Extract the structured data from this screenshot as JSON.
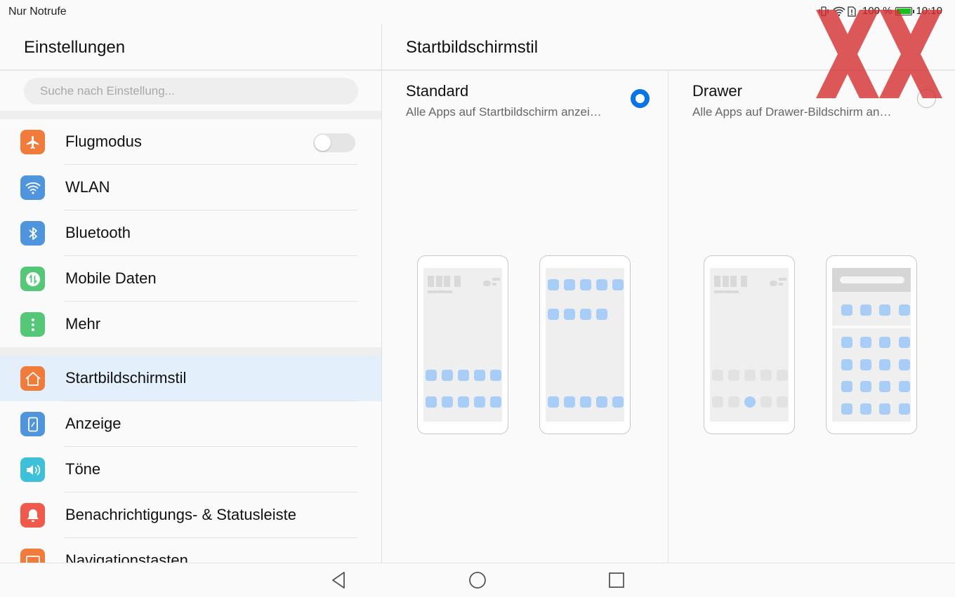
{
  "statusbar": {
    "carrier": "Nur Notrufe",
    "battery": "100 %",
    "time": "10:10"
  },
  "left": {
    "title": "Einstellungen",
    "search_placeholder": "Suche nach Einstellung...",
    "items": [
      {
        "label": "Flugmodus",
        "icon": "airplane-icon",
        "color": "#f07b3b",
        "toggle": false
      },
      {
        "label": "WLAN",
        "icon": "wifi-icon",
        "color": "#4f95dd"
      },
      {
        "label": "Bluetooth",
        "icon": "bluetooth-icon",
        "color": "#4f95dd"
      },
      {
        "label": "Mobile Daten",
        "icon": "mobile-data-icon",
        "color": "#55c878"
      },
      {
        "label": "Mehr",
        "icon": "more-icon",
        "color": "#55c878"
      },
      {
        "label": "Startbildschirmstil",
        "icon": "home-icon",
        "color": "#f07b3b",
        "active": true
      },
      {
        "label": "Anzeige",
        "icon": "display-icon",
        "color": "#4f95dd"
      },
      {
        "label": "Töne",
        "icon": "sound-icon",
        "color": "#3dc0d8"
      },
      {
        "label": "Benachrichtigungs- & Statusleiste",
        "icon": "bell-icon",
        "color": "#ef5a4a"
      },
      {
        "label": "Navigationstasten",
        "icon": "navigation-keys-icon",
        "color": "#f07b3b"
      }
    ]
  },
  "right": {
    "title": "Startbildschirmstil",
    "options": [
      {
        "title": "Standard",
        "subtitle": "Alle Apps auf Startbildschirm anzei…",
        "selected": true
      },
      {
        "title": "Drawer",
        "subtitle": "Alle Apps auf Drawer-Bildschirm an…",
        "selected": false
      }
    ]
  },
  "colors": {
    "accent": "#0a74e6",
    "active_row": "#e3effb",
    "preview_app": "#a8cdf7"
  }
}
